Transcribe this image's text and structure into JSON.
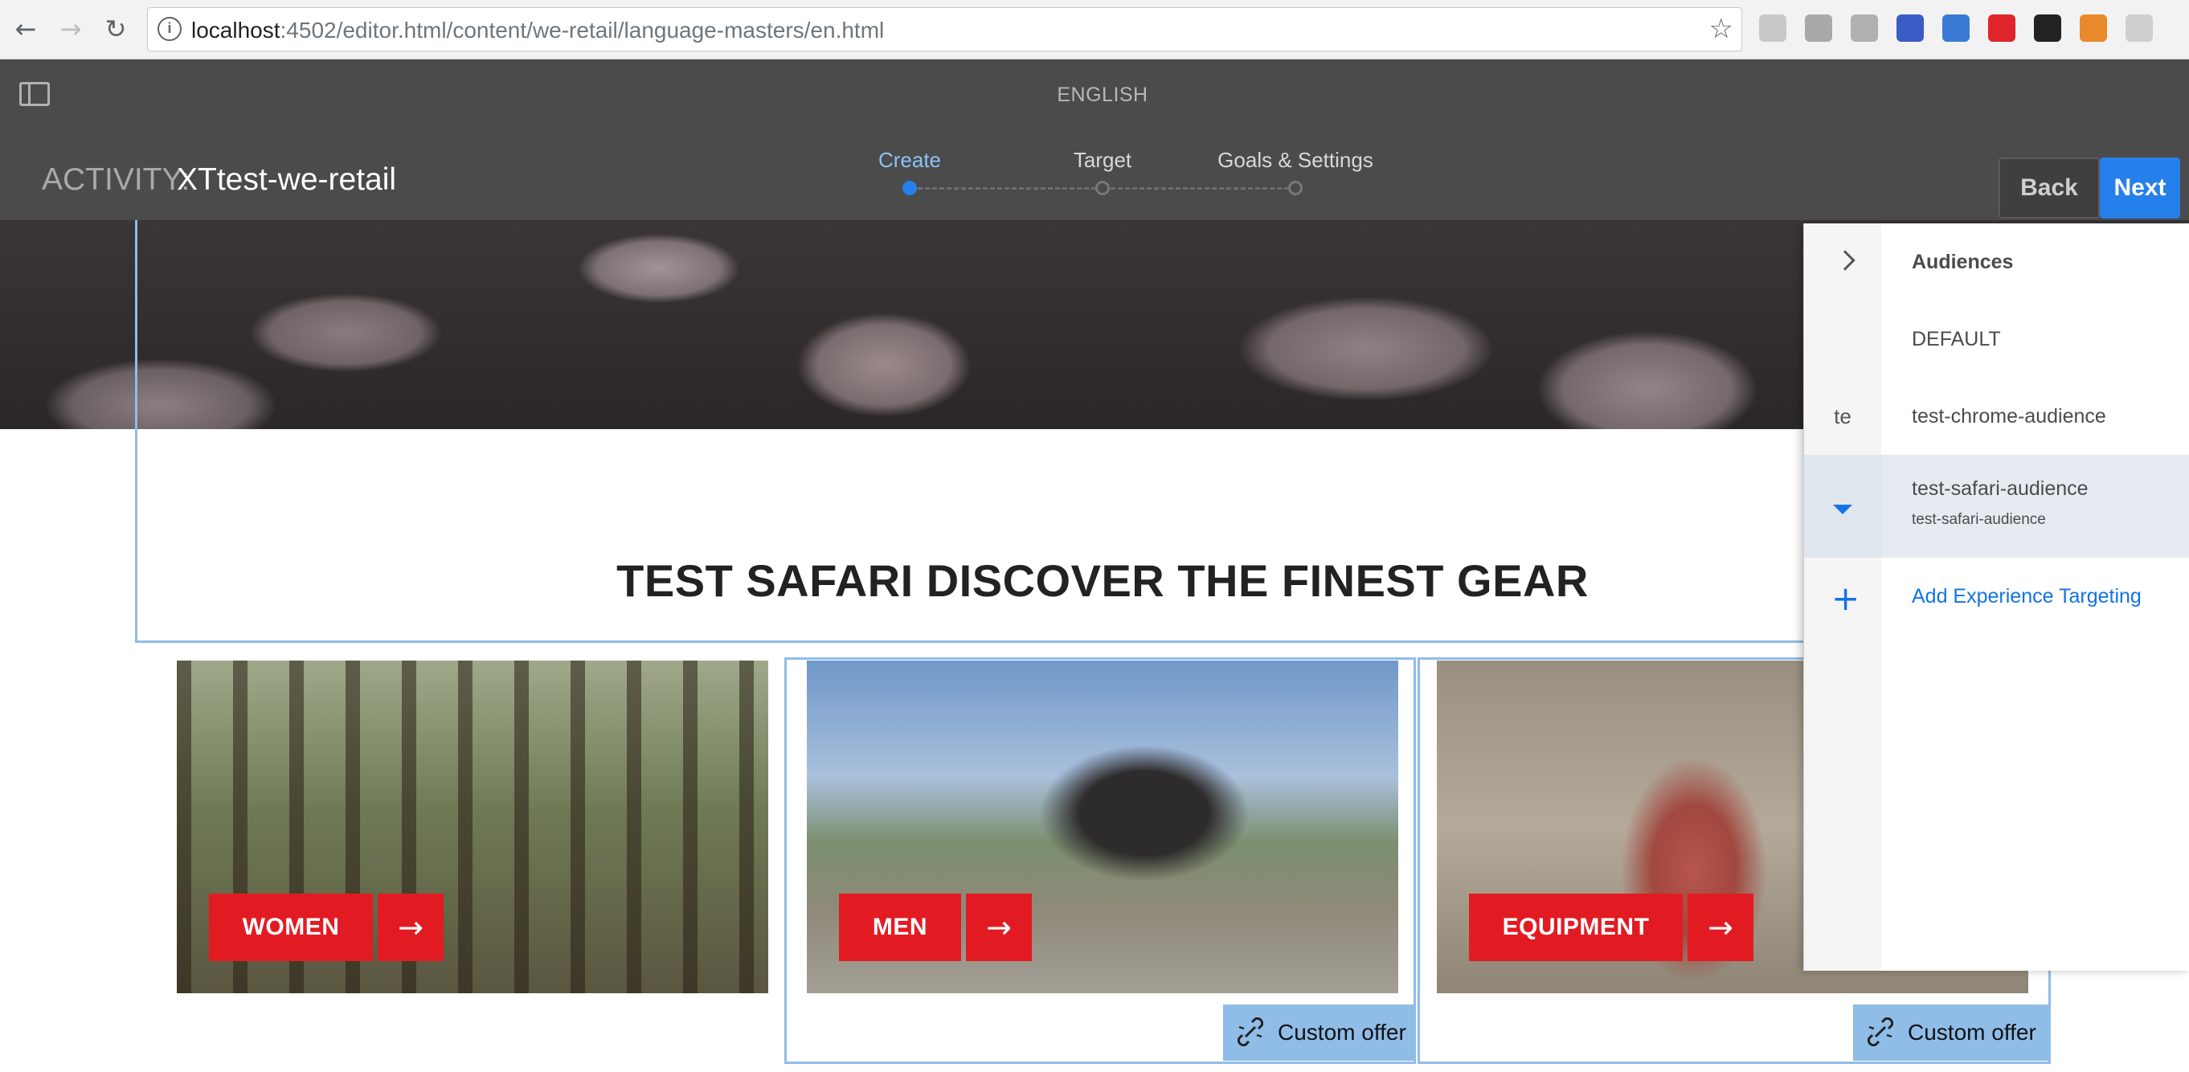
{
  "browser": {
    "url_host": "localhost",
    "url_rest": ":4502/editor.html/content/we-retail/language-masters/en.html",
    "back_glyph": "←",
    "forward_glyph": "→",
    "reload_glyph": "↻",
    "star_glyph": "☆",
    "info_glyph": "i",
    "extensions": [
      {
        "name": "ublock-icon",
        "color": "#c9c9c9"
      },
      {
        "name": "reader-icon",
        "color": "#a9a9a9"
      },
      {
        "name": "json-icon",
        "color": "#b0b0b0"
      },
      {
        "name": "bookmark-ext-icon",
        "color": "#3b5cc4"
      },
      {
        "name": "tag-ext-icon",
        "color": "#3a7bd5"
      },
      {
        "name": "opera-icon",
        "color": "#e0242b"
      },
      {
        "name": "qr-icon",
        "color": "#222222"
      },
      {
        "name": "color-picker-icon",
        "color": "#e88a2b"
      },
      {
        "name": "feather-icon",
        "color": "#cfcfcf"
      }
    ]
  },
  "aem": {
    "page_title": "ENGLISH",
    "activity_label": "ACTIVITY:",
    "activity_name": "XTtest-we-retail",
    "steps": [
      {
        "label": "Create",
        "active": true
      },
      {
        "label": "Target",
        "active": false
      },
      {
        "label": "Goals & Settings",
        "active": false
      }
    ],
    "back_label": "Back",
    "next_label": "Next",
    "colors": {
      "accent": "#2680eb",
      "header": "#4b4b4b",
      "cta": "#e21b23",
      "selection": "#8fbde8"
    }
  },
  "page": {
    "headline": "TEST SAFARI DISCOVER THE FINEST GEAR",
    "cards": [
      {
        "label": "WOMEN",
        "arrow": "→"
      },
      {
        "label": "MEN",
        "arrow": "→"
      },
      {
        "label": "EQUIPMENT",
        "arrow": "→"
      }
    ],
    "offers": [
      {
        "label": "Custom offer"
      },
      {
        "label": "Custom offer"
      }
    ]
  },
  "audiences": {
    "title": "Audiences",
    "rows": [
      {
        "gutter": "",
        "label": "DEFAULT",
        "sublabel": ""
      },
      {
        "gutter": "te",
        "label": "test-chrome-audience",
        "sublabel": ""
      },
      {
        "gutter": "",
        "label": "test-safari-audience",
        "sublabel": "test-safari-audience"
      }
    ],
    "add_label": "Add Experience Targeting"
  }
}
